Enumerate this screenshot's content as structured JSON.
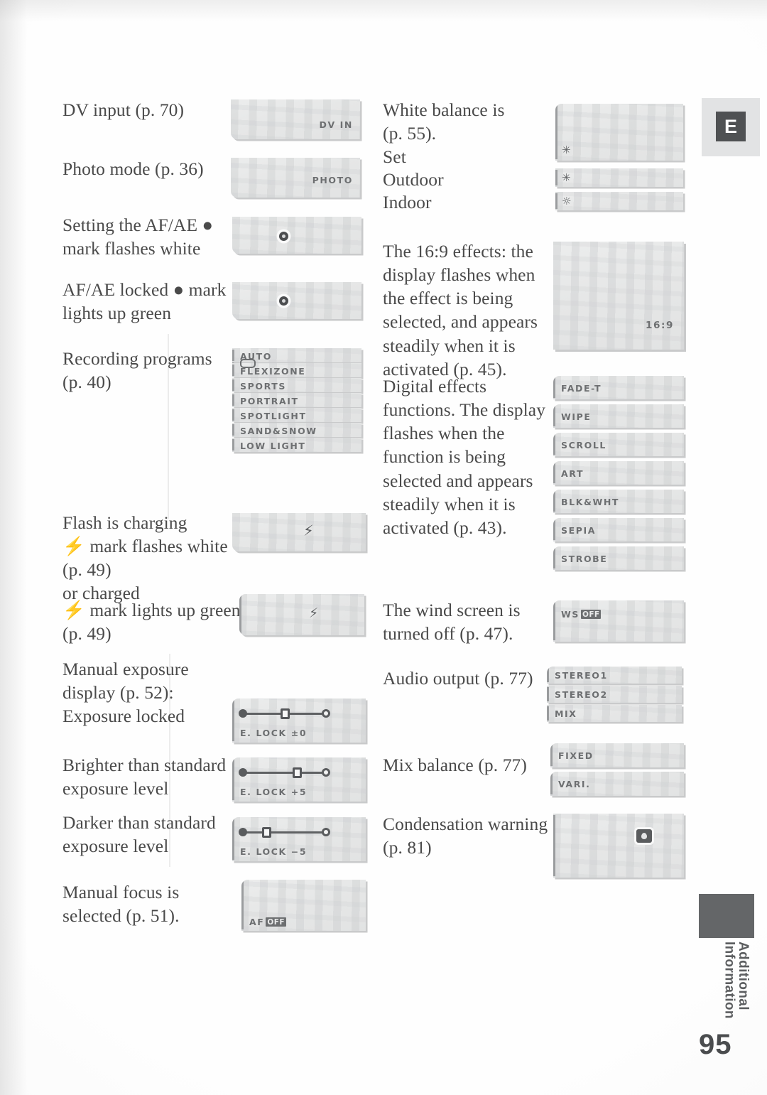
{
  "page": {
    "number": "95",
    "side_tab_label": "Additional\nInformation",
    "language_tab": "E"
  },
  "left_column": [
    {
      "id": "dv-input",
      "text": "DV input (p. 70)"
    },
    {
      "id": "photo-mode",
      "text": "Photo mode (p. 36)"
    },
    {
      "id": "afae-setting",
      "text": "Setting the AF/AE ●\nmark flashes white"
    },
    {
      "id": "afae-locked",
      "text": "AF/AE locked ● mark\nlights up green"
    },
    {
      "id": "recording-programs",
      "text": "Recording programs\n(p. 40)"
    },
    {
      "id": "flash-charging",
      "text": "Flash is charging\n⚡ mark flashes white\n(p. 49)\nor charged"
    },
    {
      "id": "flash-charged",
      "text": "⚡ mark lights up green\n(p. 49)"
    },
    {
      "id": "manual-exposure",
      "text": "Manual exposure\ndisplay (p. 52):\nExposure locked"
    },
    {
      "id": "brighter-exposure",
      "text": "Brighter than standard\nexposure level"
    },
    {
      "id": "darker-exposure",
      "text": "Darker than standard\nexposure level"
    },
    {
      "id": "manual-focus",
      "text": "Manual focus is\nselected (p. 51)."
    }
  ],
  "right_column": [
    {
      "id": "white-balance",
      "text": "White balance is\n(p. 55)."
    },
    {
      "id": "wb-set",
      "text": "Set"
    },
    {
      "id": "wb-outdoor",
      "text": "Outdoor"
    },
    {
      "id": "wb-indoor",
      "text": "Indoor"
    },
    {
      "id": "effects-169",
      "text": "The 16:9 effects: the\ndisplay flashes when\nthe effect is being\nselected, and appears\nsteadily when it is\nactivated (p. 45)."
    },
    {
      "id": "digital-effects",
      "text": "Digital effects\nfunctions. The display\nflashes when the\nfunction is being\nselected and appears\nsteadily when it is\nactivated (p. 43)."
    },
    {
      "id": "wind-screen",
      "text": "The wind screen is\nturned off (p. 47)."
    },
    {
      "id": "audio-output",
      "text": "Audio output (p. 77)"
    },
    {
      "id": "mix-balance",
      "text": "Mix balance (p. 77)"
    },
    {
      "id": "condensation",
      "text": "Condensation warning\n(p. 81)"
    }
  ],
  "panels": {
    "dv_in": {
      "osd": "DV IN"
    },
    "photo": {
      "osd": "PHOTO"
    },
    "recording_programs": [
      "AUTO",
      "FLEXIZONE",
      "SPORTS",
      "PORTRAIT",
      "SPOTLIGHT",
      "SAND&SNOW",
      "LOW LIGHT"
    ],
    "exposure": [
      {
        "osd": "E. LOCK ±0",
        "knob_pct": 42
      },
      {
        "osd": "E. LOCK +5",
        "knob_pct": 52
      },
      {
        "osd": "E. LOCK −5",
        "knob_pct": 22
      }
    ],
    "manual_focus": {
      "osd": "AF",
      "badge": "OFF"
    },
    "aspect_169": {
      "osd": "16:9"
    },
    "digital_effects": [
      "FADE-T",
      "WIPE",
      "SCROLL",
      "ART",
      "BLK&WHT",
      "SEPIA",
      "STROBE"
    ],
    "wind_screen": {
      "osd": "WS",
      "badge": "OFF"
    },
    "audio_output": [
      "STEREO1",
      "STEREO2",
      "MIX"
    ],
    "mix_balance": [
      "FIXED",
      "VARI."
    ]
  },
  "colors": {
    "page_background": "#fefefe",
    "body_text": "#4a4a4a",
    "lcd_panel": "#e8e9e9",
    "lcd_text": "#6d6f71",
    "tab_dark": "#4f5153"
  }
}
